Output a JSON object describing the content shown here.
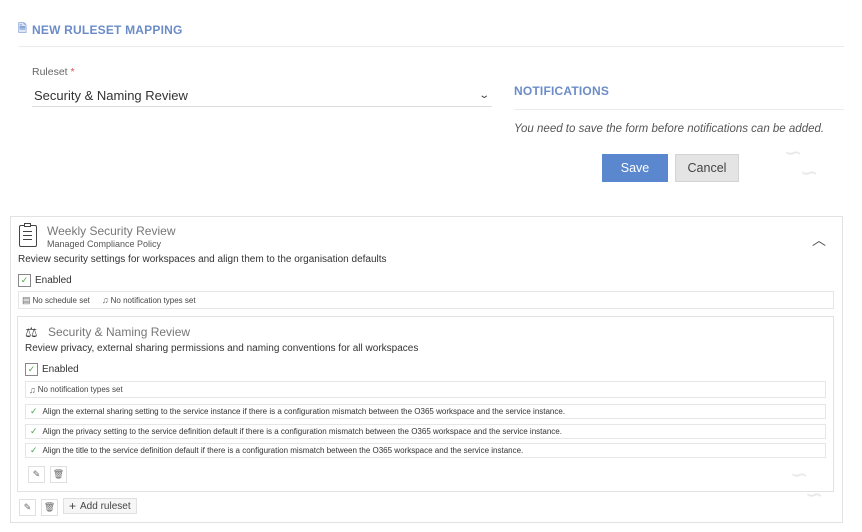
{
  "header": {
    "title": "NEW RULESET MAPPING"
  },
  "ruleset_field": {
    "label": "Ruleset",
    "required_mark": "*",
    "value": "Security & Naming Review"
  },
  "notifications": {
    "title": "NOTIFICATIONS",
    "message": "You need to save the form before notifications can be added."
  },
  "actions": {
    "save_label": "Save",
    "cancel_label": "Cancel"
  },
  "policy": {
    "name": "Weekly Security Review",
    "type": "Managed Compliance Policy",
    "description": "Review security settings for workspaces and align them to the organisation defaults",
    "enabled_label": "Enabled",
    "schedule": "No schedule set",
    "notification_types": "No notification types set",
    "add_ruleset_label": "Add ruleset"
  },
  "ruleset_card": {
    "name": "Security & Naming Review",
    "description": "Review privacy, external sharing permissions and naming conventions for all workspaces",
    "enabled_label": "Enabled",
    "notification_types": "No notification types set",
    "rules": [
      "Align the external sharing setting to the service instance if there is a configuration mismatch between the O365 workspace and the service instance.",
      "Align the privacy setting to the service definition default if there is a configuration mismatch between the O365 workspace and the service instance.",
      "Align the title to the service definition default if there is a configuration mismatch between the O365 workspace and the service instance."
    ]
  },
  "colors": {
    "accent": "#6b8cc7",
    "primary_button": "#5b87cf",
    "check": "#4aa64a"
  }
}
